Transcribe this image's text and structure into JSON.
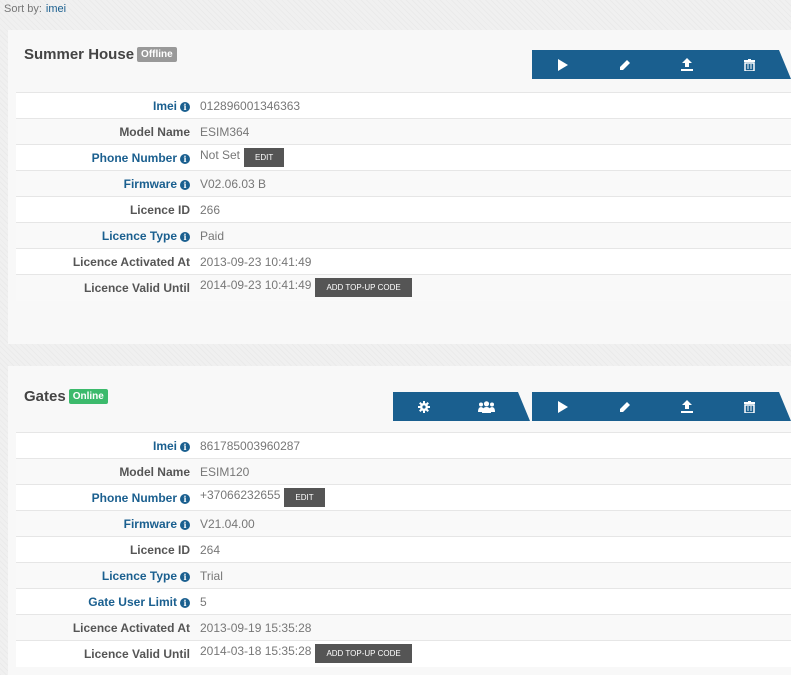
{
  "sort": {
    "label": "Sort by:",
    "value": "imei"
  },
  "devices": [
    {
      "name": "Summer House",
      "status": "Offline",
      "status_color": "#999999",
      "row1": {
        "label": "Imei",
        "value": "012896001346363"
      },
      "row2": {
        "label": "Model Name",
        "value": "ESIM364"
      },
      "row3": {
        "label": "Phone Number",
        "value": "Not Set",
        "button": "EDIT"
      },
      "row4": {
        "label": "Firmware",
        "value": "V02.06.03 B"
      },
      "row5": {
        "label": "Licence ID",
        "value": "266"
      },
      "row6": {
        "label": "Licence Type",
        "value": "Paid"
      },
      "row7": {
        "label": "Licence Activated At",
        "value": "2013-09-23 10:41:49"
      },
      "row8": {
        "label": "Licence Valid Until",
        "value": "2014-09-23 10:41:49",
        "button": "ADD TOP-UP CODE"
      },
      "actions": [
        "play-icon",
        "pencil-icon",
        "upload-icon",
        "trash-icon"
      ]
    },
    {
      "name": "Gates",
      "status": "Online",
      "status_color": "#3cba6c",
      "row1": {
        "label": "Imei",
        "value": "861785003960287"
      },
      "row2": {
        "label": "Model Name",
        "value": "ESIM120"
      },
      "row3": {
        "label": "Phone Number",
        "value": "+37066232655",
        "button": "EDIT"
      },
      "row4": {
        "label": "Firmware",
        "value": "V21.04.00"
      },
      "row5": {
        "label": "Licence ID",
        "value": "264"
      },
      "row6": {
        "label": "Licence Type",
        "value": "Trial"
      },
      "row7": {
        "label": "Gate User Limit",
        "value": "5"
      },
      "row8": {
        "label": "Licence Activated At",
        "value": "2013-09-19 15:35:28"
      },
      "row9": {
        "label": "Licence Valid Until",
        "value": "2014-03-18 15:35:28",
        "button": "ADD TOP-UP CODE"
      },
      "settings_actions": [
        "gear-icon",
        "users-icon"
      ],
      "actions": [
        "play-icon",
        "pencil-icon",
        "upload-icon",
        "trash-icon"
      ]
    }
  ],
  "colors": {
    "accent": "#1a5f8f",
    "online": "#3cba6c",
    "offline": "#999999",
    "button": "#555555"
  }
}
